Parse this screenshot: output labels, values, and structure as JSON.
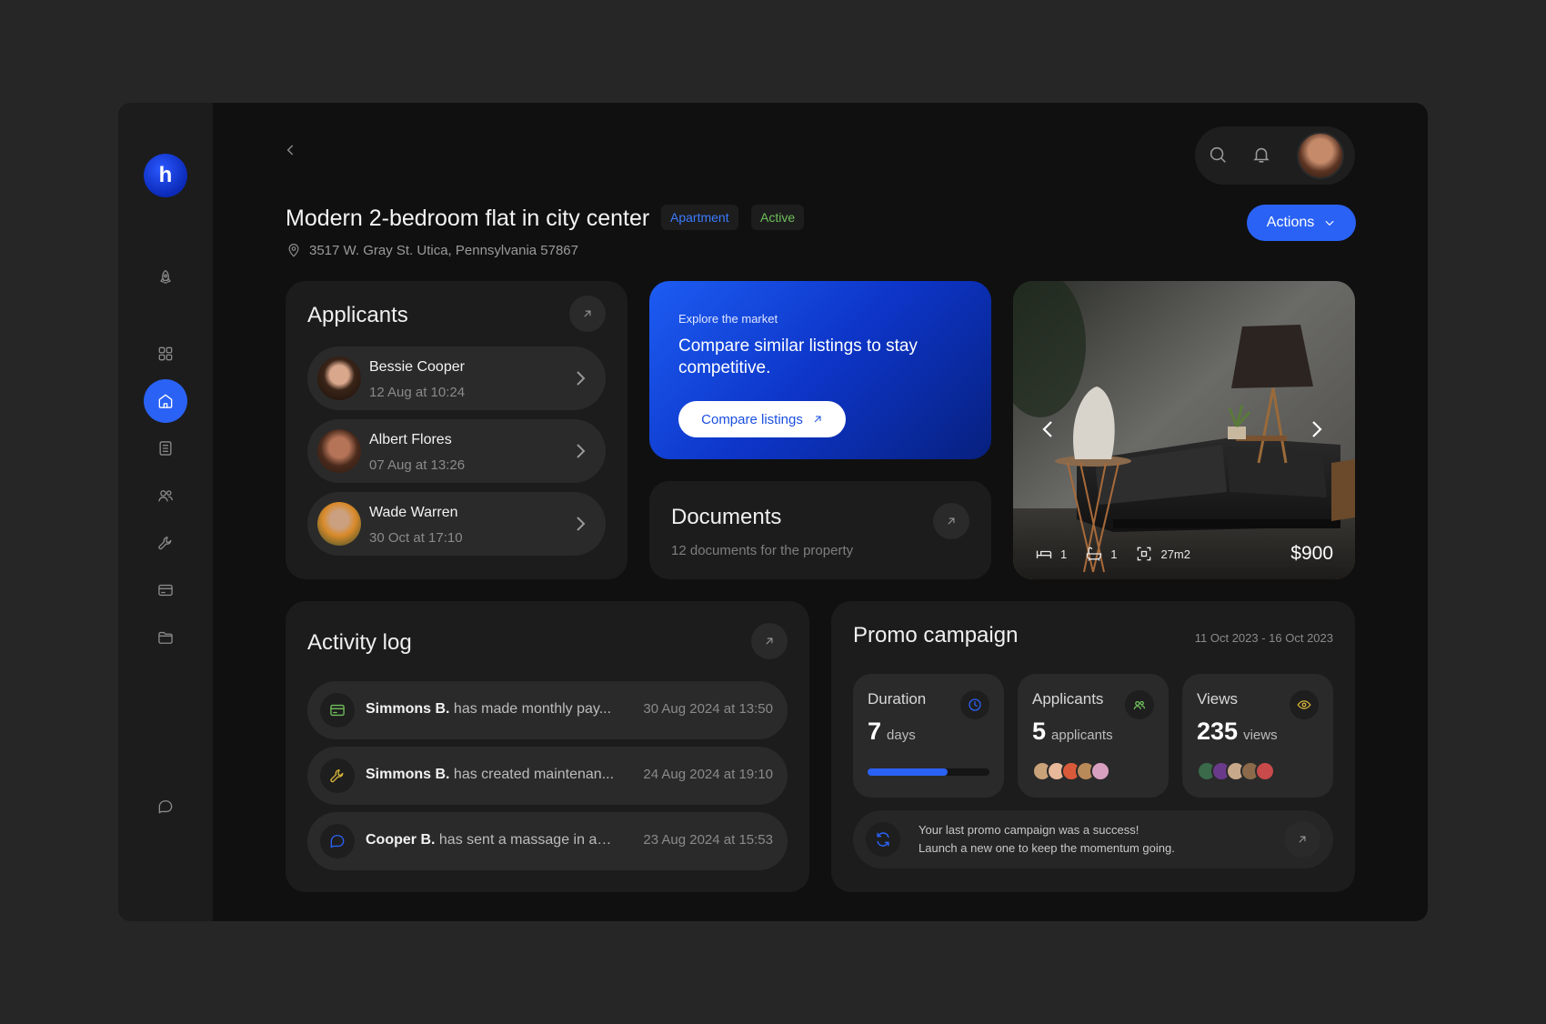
{
  "brand": {
    "logo_letter": "h"
  },
  "sidebar": {
    "items": [
      {
        "icon": "rocket-icon"
      },
      {
        "icon": "grid-icon"
      },
      {
        "icon": "home-icon",
        "active": true
      },
      {
        "icon": "document-list-icon"
      },
      {
        "icon": "users-icon"
      },
      {
        "icon": "wrench-icon"
      },
      {
        "icon": "card-icon"
      },
      {
        "icon": "folder-icon"
      }
    ],
    "bottom_icon": "chat-icon"
  },
  "property": {
    "title": "Modern 2-bedroom flat in city center",
    "type_tag": "Apartment",
    "status_tag": "Active",
    "address": "3517 W. Gray St. Utica, Pennsylvania 57867"
  },
  "header": {
    "actions_label": "Actions"
  },
  "applicants": {
    "title": "Applicants",
    "items": [
      {
        "name": "Bessie Cooper",
        "date": "12 Aug at 10:24"
      },
      {
        "name": "Albert Flores",
        "date": "07 Aug at 13:26"
      },
      {
        "name": "Wade Warren",
        "date": "30 Oct at 17:10"
      }
    ]
  },
  "explore": {
    "kicker": "Explore the market",
    "headline": "Compare similar listings to stay competitive.",
    "button": "Compare listings"
  },
  "documents": {
    "title": "Documents",
    "subtitle": "12 documents for the property"
  },
  "listing_photo": {
    "beds": "1",
    "baths": "1",
    "area": "27m2",
    "price": "$900"
  },
  "activity": {
    "title": "Activity log",
    "items": [
      {
        "icon": "card-icon",
        "actor": "Simmons B.",
        "text": "has made monthly pay...",
        "when": "30 Aug 2024 at 13:50",
        "color": "#6fbf5c"
      },
      {
        "icon": "wrench-icon",
        "actor": "Simmons B.",
        "text": "has created maintenan...",
        "when": "24 Aug 2024 at 19:10",
        "color": "#d9b43a"
      },
      {
        "icon": "chat-icon",
        "actor": "Cooper B.",
        "text": "has sent a massage in ap...",
        "when": "23 Aug 2024 at 15:53",
        "color": "#2a62f5"
      }
    ]
  },
  "promo": {
    "title": "Promo campaign",
    "date_range": "11 Oct 2023 - 16 Oct 2023",
    "duration": {
      "label": "Duration",
      "value": "7",
      "unit": "days",
      "progress": 0.66
    },
    "applicants": {
      "label": "Applicants",
      "value": "5",
      "unit": "applicants"
    },
    "views": {
      "label": "Views",
      "value": "235",
      "unit": "views"
    },
    "message_line1": "Your last promo campaign was a success!",
    "message_line2": "Launch a new one to keep the momentum going."
  },
  "colors": {
    "accent": "#2a62f5",
    "bg": "#101010",
    "card": "#1c1c1c"
  }
}
